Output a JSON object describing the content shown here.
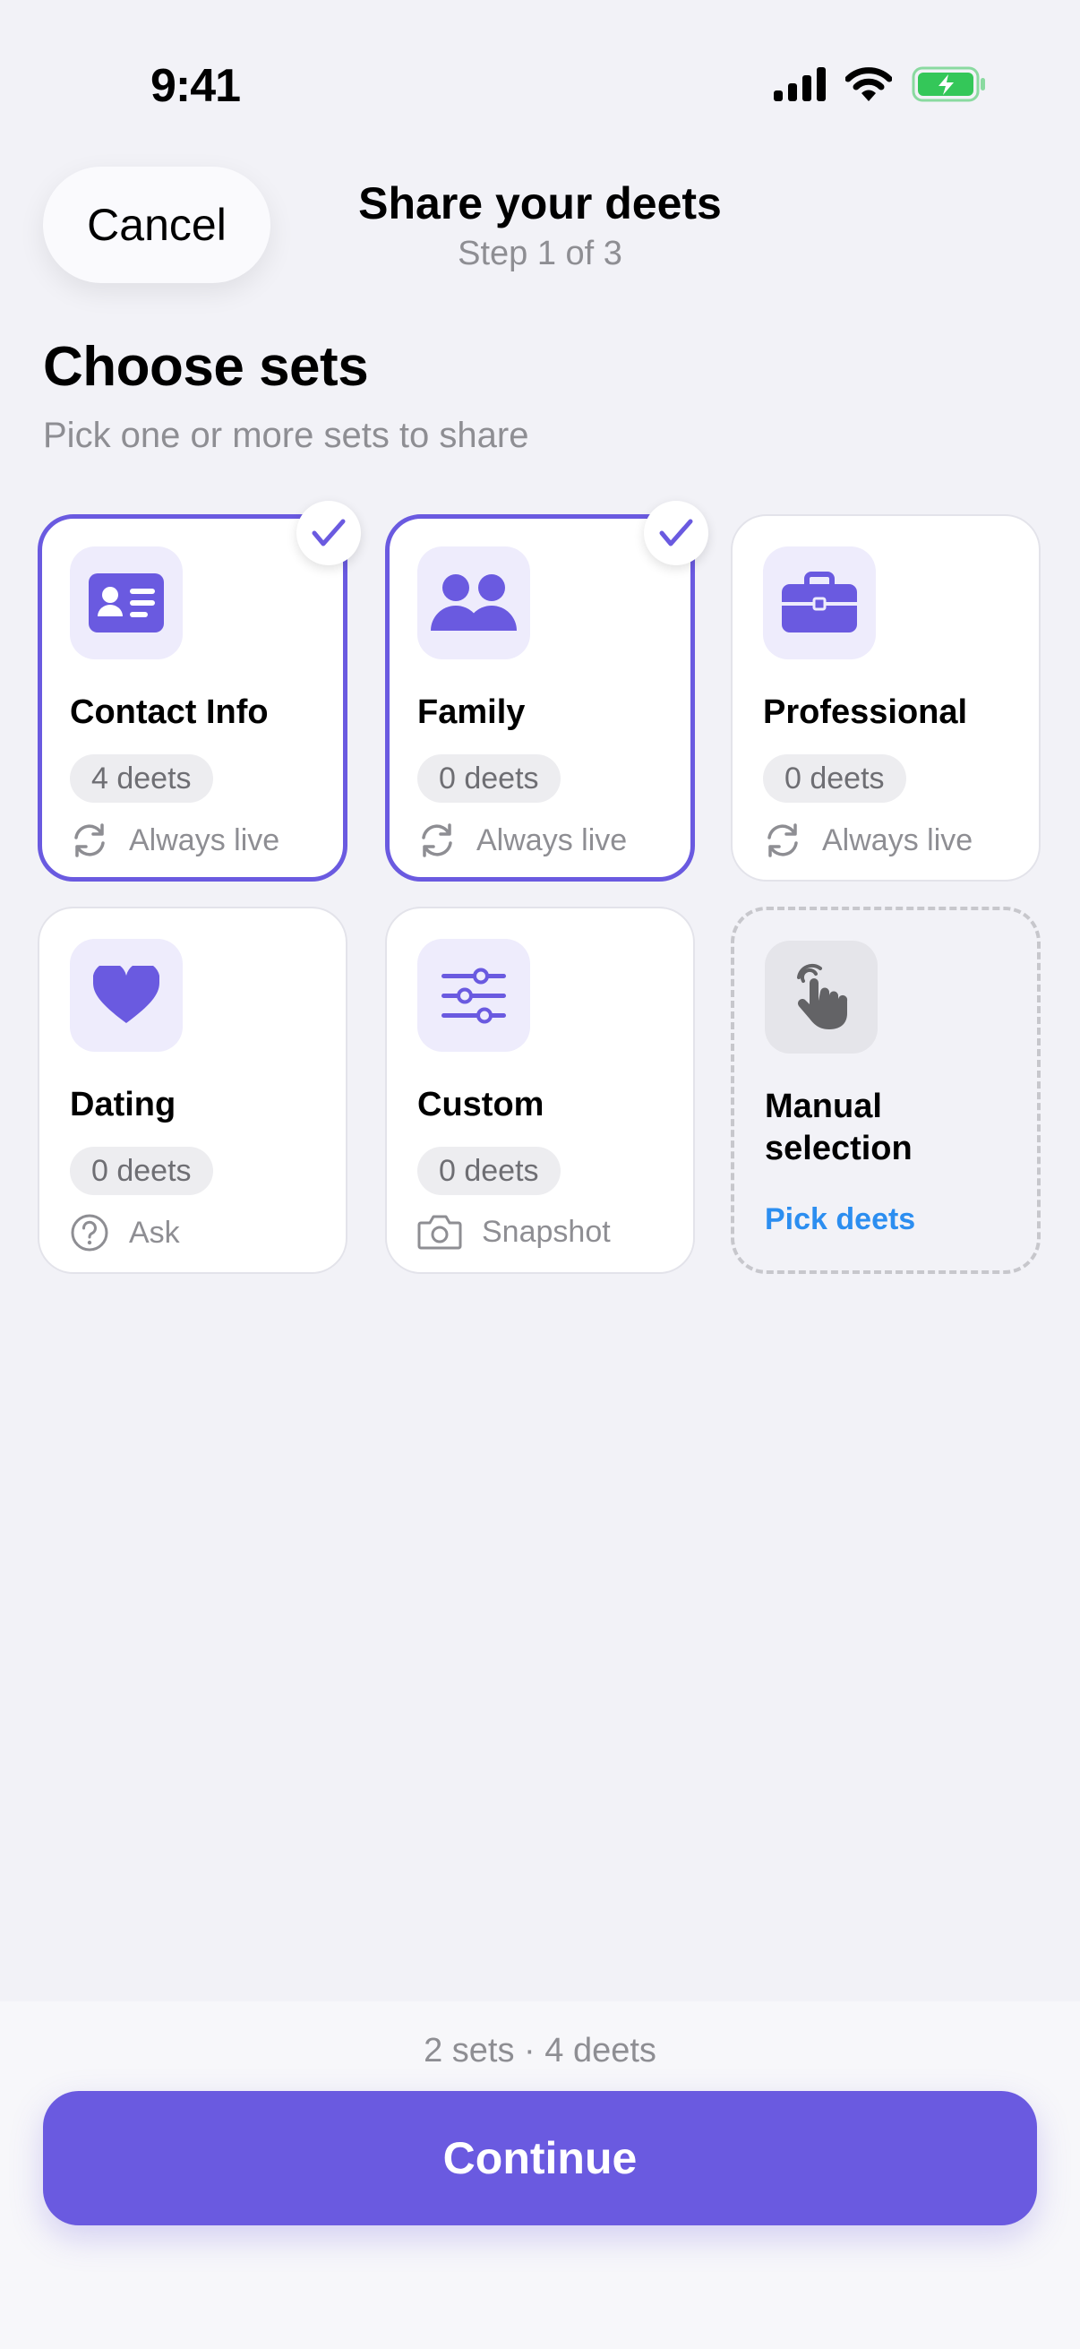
{
  "status_bar": {
    "time": "9:41"
  },
  "nav": {
    "cancel_label": "Cancel",
    "title": "Share your deets",
    "subtitle": "Step 1 of 3"
  },
  "section": {
    "title": "Choose sets",
    "subtitle": "Pick one or more sets to share"
  },
  "cards": [
    {
      "title": "Contact Info",
      "count": "4 deets",
      "mode": "Always live",
      "selected": true,
      "icon": "contact-card-icon"
    },
    {
      "title": "Family",
      "count": "0 deets",
      "mode": "Always live",
      "selected": true,
      "icon": "people-icon"
    },
    {
      "title": "Professional",
      "count": "0 deets",
      "mode": "Always live",
      "selected": false,
      "icon": "briefcase-icon"
    },
    {
      "title": "Dating",
      "count": "0 deets",
      "mode": "Ask",
      "selected": false,
      "icon": "heart-icon"
    },
    {
      "title": "Custom",
      "count": "0 deets",
      "mode": "Snapshot",
      "selected": false,
      "icon": "sliders-icon"
    },
    {
      "title": "Manual selection",
      "link": "Pick deets",
      "icon": "hand-pointer-icon"
    }
  ],
  "footer": {
    "summary": "2 sets · 4 deets",
    "continue_label": "Continue"
  },
  "colors": {
    "accent": "#6a5ae0",
    "link": "#2c8ef0",
    "battery": "#34c759"
  }
}
